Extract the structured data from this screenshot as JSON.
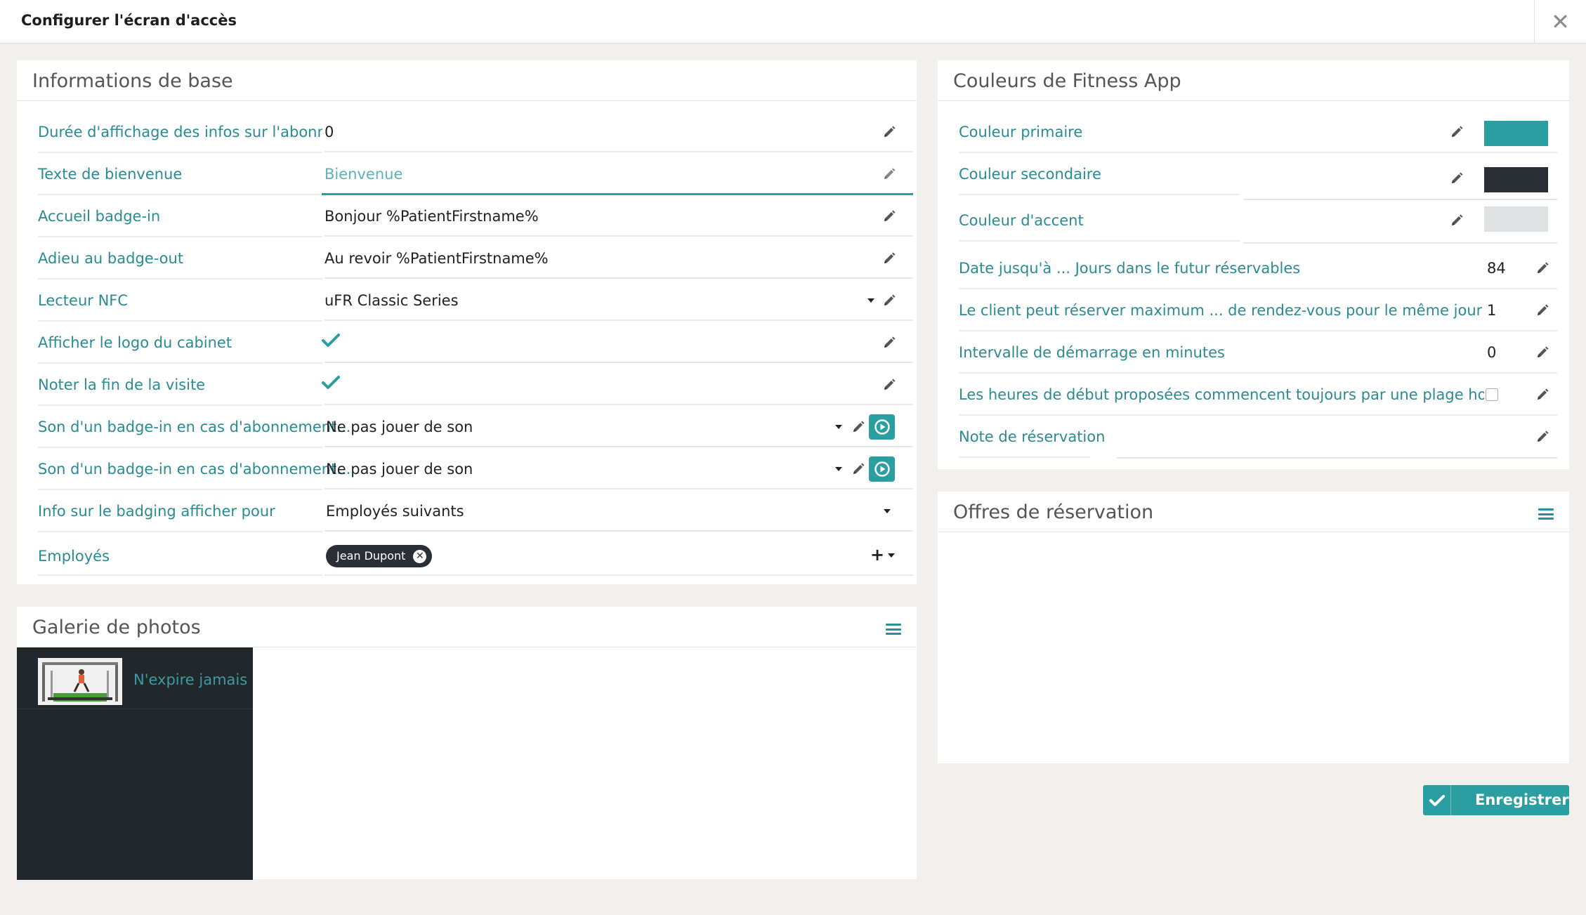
{
  "dialog": {
    "title": "Configurer l'écran d'accès",
    "close_label": "✕"
  },
  "basic_info": {
    "title": "Informations de base",
    "fields": {
      "display_duration": {
        "label": "Durée d'affichage des infos sur l'abonnement",
        "value": "0"
      },
      "welcome_text": {
        "label": "Texte de bienvenue",
        "placeholder": "Bienvenue",
        "value": ""
      },
      "badge_in": {
        "label": "Accueil badge-in",
        "value": "Bonjour %PatientFirstname%"
      },
      "badge_out": {
        "label": "Adieu au badge-out",
        "value": "Au revoir %PatientFirstname%"
      },
      "nfc_reader": {
        "label": "Lecteur NFC",
        "value": "uFR Classic Series"
      },
      "show_logo": {
        "label": "Afficher le logo du cabinet",
        "checked": true
      },
      "note_end_visit": {
        "label": "Noter la fin de la visite",
        "checked": true
      },
      "sound_1": {
        "label": "Son d'un badge-in en cas d'abonnement...",
        "value": "Ne pas jouer de son"
      },
      "sound_2": {
        "label": "Son d'un badge-in en cas d'abonnement...",
        "value": "Ne pas jouer de son"
      },
      "badging_info": {
        "label": "Info sur le badging afficher pour",
        "value": "Employés suivants"
      },
      "employees": {
        "label": "Employés",
        "tags": [
          "Jean Dupont"
        ],
        "add_label": "+"
      }
    }
  },
  "colors": {
    "title": "Couleurs de Fitness App",
    "primary": {
      "label": "Couleur primaire",
      "color": "#2a9ea0"
    },
    "secondary": {
      "label": "Couleur secondaire",
      "color": "#2a2f35"
    },
    "accent": {
      "label": "Couleur d'accent",
      "color": "#dfe3e4"
    },
    "future_days": {
      "label": "Date jusqu'à ... Jours dans le futur réservables",
      "value": "84"
    },
    "max_same_day": {
      "label": "Le client peut réserver maximum ... de rendez-vous pour le même jour",
      "value": "1"
    },
    "start_interval": {
      "label": "Intervalle de démarrage en minutes",
      "value": "0"
    },
    "free_slot": {
      "label": "Les heures de début proposées commencent toujours par une plage horaire libre",
      "checked": false
    },
    "booking_note": {
      "label": "Note de réservation",
      "value": ""
    }
  },
  "booking_offers": {
    "title": "Offres de réservation"
  },
  "gallery": {
    "title": "Galerie de photos",
    "items": [
      {
        "caption": "N'expire jamais"
      }
    ]
  },
  "actions": {
    "save_label": "Enregistrer"
  },
  "theme": {
    "accent": "#2a9ea0",
    "label_color": "#2a8b92",
    "dark": "#22272c"
  }
}
